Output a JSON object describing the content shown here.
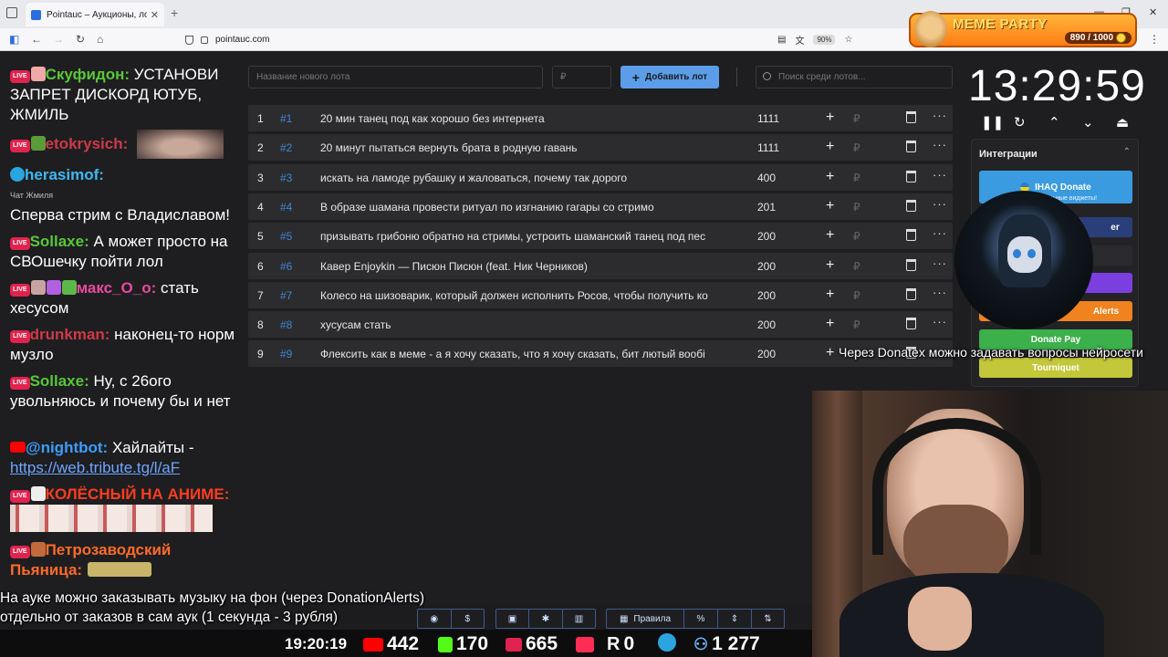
{
  "browser": {
    "tab_title": "Pointauc – Аукционы, лотереи",
    "tab_close": "✕",
    "new_tab": "+",
    "url": "pointauc.com",
    "zoom": "90%",
    "menu": "⋮",
    "window_controls": [
      "⌄",
      "—",
      "❐",
      "✕"
    ]
  },
  "meme_party": {
    "title": "MEME PARTY",
    "counter": "890 / 1000"
  },
  "chat": {
    "chat_hint": "Чат Жмиля",
    "messages": [
      {
        "user": "Скуфидон:",
        "text": " УСТАНОВИ ЗАПРЕТ ДИСКОРД ЮТУБ, ЖМИЛЬ"
      },
      {
        "user": "etokrysich:",
        "text": ""
      },
      {
        "user": "herasimof:",
        "text": ""
      },
      {
        "user": "",
        "text": "Сперва стрим с Владиславом!"
      },
      {
        "user": "Sollaxe:",
        "text": " А может просто на СВОшечку пойти лол"
      },
      {
        "user": "макс_О_о:",
        "text": " стать хесусом"
      },
      {
        "user": "drunkman:",
        "text": " наконец-то норм музло"
      },
      {
        "user": "Sollaxe:",
        "text": " Ну, с 26ого увольняюсь и почему бы и нет"
      },
      {
        "user": "@nightbot:",
        "text": " Хайлайты - ",
        "link": "https://web.tribute.tg/l/aF"
      },
      {
        "user": "КОЛЁСНЫЙ НА АНИМЕ:",
        "text": ""
      },
      {
        "user": "Петрозаводский",
        "text": "",
        "user2": "Пьяница:"
      }
    ]
  },
  "auction": {
    "lot_placeholder": "Название нового лота",
    "rub_placeholder": "₽",
    "add_button": "Добавить лот",
    "search_placeholder": "Поиск среди лотов...",
    "lots": [
      {
        "num": "1",
        "id": "#1",
        "name": "20 мин танец под как хорошо без интернета",
        "amount": "1111"
      },
      {
        "num": "2",
        "id": "#2",
        "name": "20 минут пытаться вернуть брата в родную гавань",
        "amount": "1111"
      },
      {
        "num": "3",
        "id": "#3",
        "name": "искать на ламоде рубашку и жаловаться, почему так дорого",
        "amount": "400"
      },
      {
        "num": "4",
        "id": "#4",
        "name": "В образе шамана провести ритуал по изгнанию гагары со стримо",
        "amount": "201"
      },
      {
        "num": "5",
        "id": "#5",
        "name": "призывать грибоню обратно на стримы, устроить шаманский танец под пес",
        "amount": "200"
      },
      {
        "num": "6",
        "id": "#6",
        "name": "Кавер Enjoykin — Писюн Писюн (feat. Ник Черников)",
        "amount": "200"
      },
      {
        "num": "7",
        "id": "#7",
        "name": "Колесо на шизоварик, который должен исполнить Росов, чтобы получить ко",
        "amount": "200"
      },
      {
        "num": "8",
        "id": "#8",
        "name": "хусусам стать",
        "amount": "200"
      },
      {
        "num": "9",
        "id": "#9",
        "name": "Флексить как в меме - а я хочу сказать, что я хочу сказать, бит лютый вообі",
        "amount": "200"
      }
    ],
    "row_plus": "+",
    "row_rub": "₽",
    "row_more": "···"
  },
  "timer": {
    "value": "13:29:59",
    "controls": [
      "❚❚",
      "↻",
      "⌃",
      "⌄",
      "⏏"
    ]
  },
  "integrations": {
    "title": "Интеграции",
    "chevron": "⌃",
    "buttons": [
      {
        "label": "IHAQ Donate",
        "sub": "Кастомные уникальные виджеты!",
        "color": "#3a9be0"
      },
      {
        "label": "er",
        "color": "#2a3f7a"
      },
      {
        "label": "",
        "color": "#2a2a2e"
      },
      {
        "label": "",
        "color": "#7b3fe0"
      },
      {
        "label": "Alerts",
        "color": "#f0821f"
      },
      {
        "label": "Donate Pay",
        "color": "#3cb04a"
      },
      {
        "label": "Tourniquet",
        "color": "#c3c83a"
      }
    ]
  },
  "overlay": {
    "donatex_note": "Через Donatex можно задавать вопросы нейросети",
    "music_note_1": "На ауке можно заказывать музыку на фон (через DonationAlerts)",
    "music_note_2": "отдельно от заказов в сам аук (1 секунда - 3 рубля)"
  },
  "toolbar": {
    "rules_label": "Правила",
    "percent": "%"
  },
  "stats": {
    "time": "19:20:19",
    "youtube": "442",
    "kick": "170",
    "live": "665",
    "r_count": "0",
    "viewers": "1 277"
  }
}
